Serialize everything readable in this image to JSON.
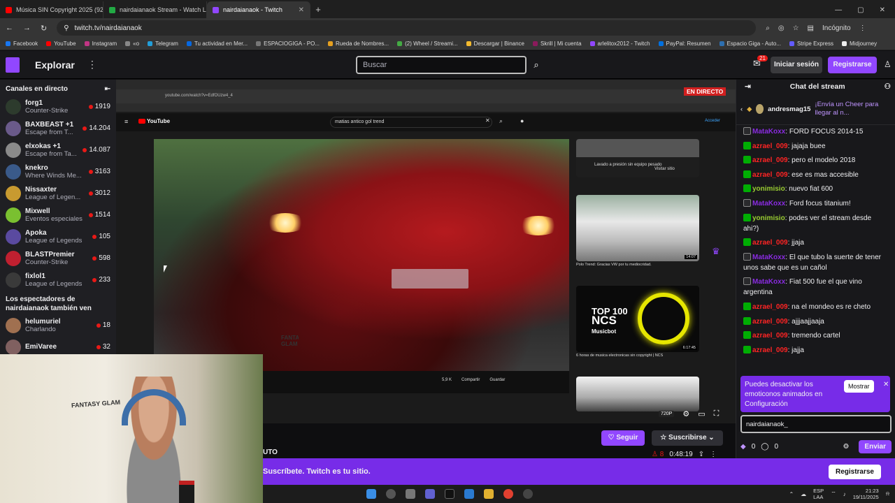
{
  "browser": {
    "tabs": [
      {
        "label": "Música SIN Copyright 2025 (92",
        "color": "#ff0000"
      },
      {
        "label": "nairdaianaok Stream - Watch Li",
        "color": "#22aa44"
      },
      {
        "label": "nairdaianaok - Twitch",
        "color": "#9147ff"
      }
    ],
    "new_tab": "+",
    "url": "twitch.tv/nairdaianaok",
    "mode": "Incógnito",
    "bookmarks": [
      "Facebook",
      "YouTube",
      "Instagram",
      "«o",
      "Telegram",
      "Tu actividad en Mer...",
      "ESPACIOGIGA - PO...",
      "Rueda de Nombres...",
      "(2) Wheel / Streami...",
      "Descargar | Binance",
      "Skrill | Mi cuenta",
      "arlelitox2012 - Twitch",
      "PayPal: Resumen",
      "Espacio Giga - Auto...",
      "Stripe Express",
      "Midjourney"
    ]
  },
  "twitch_nav": {
    "explore": "Explorar",
    "search_placeholder": "Buscar",
    "notif_count": "21",
    "login": "Iniciar sesión",
    "signup": "Registrarse"
  },
  "sidebar": {
    "title": "Canales en directo",
    "channels": [
      {
        "name": "forg1",
        "game": "Counter-Strike",
        "viewers": "1919",
        "color": "#2d3b2d"
      },
      {
        "name": "BAXBEAST +1",
        "game": "Escape from T...",
        "viewers": "14.204",
        "color": "#6a5a8a"
      },
      {
        "name": "elxokas +1",
        "game": "Escape from Ta...",
        "viewers": "14.087",
        "color": "#8a8a8a"
      },
      {
        "name": "knekro",
        "game": "Where Winds Me...",
        "viewers": "3163",
        "color": "#3a5a8a"
      },
      {
        "name": "Nissaxter",
        "game": "League of Legen...",
        "viewers": "3012",
        "color": "#c89a30"
      },
      {
        "name": "Mixwell",
        "game": "Eventos especiales",
        "viewers": "1514",
        "color": "#7ac030"
      },
      {
        "name": "Apoka",
        "game": "League of Legends",
        "viewers": "105",
        "color": "#5a4aa0"
      },
      {
        "name": "BLASTPremier",
        "game": "Counter-Strike",
        "viewers": "598",
        "color": "#c02030"
      },
      {
        "name": "fixlol1",
        "game": "League of Legends",
        "viewers": "233",
        "color": "#3a3a3a"
      }
    ],
    "section2": "Los espectadores de nairdaianaok también ven",
    "channels2": [
      {
        "name": "helumuriel",
        "game": "Charlando",
        "viewers": "18",
        "color": "#a07050"
      },
      {
        "name": "EmiVaree",
        "game": "",
        "viewers": "32",
        "color": "#806060"
      }
    ]
  },
  "video": {
    "live_badge": "EN DIRECTO",
    "youtube": {
      "logo": "YouTube",
      "search": "matias antico gol trend",
      "login": "Acceder",
      "url": "youtube.com/watch?v=EdfOUzw4_4",
      "ad_text": "Lavado a presión sin equipo pesado",
      "ad_button": "Visitar sitio",
      "rec1": "Polo Trend: Gracias VW por tu mediocridad.",
      "rec1_time": "14:07",
      "rec2_top": "TOP 100",
      "rec2_ncs": "NCS",
      "rec2_sub": "Musicbot",
      "rec2_title": "6 horas de musica electronicas sin copyright | NCS",
      "rec2_time": "6:17:45",
      "likes": "5,9 K",
      "share": "Compartir",
      "save": "Guardar"
    },
    "quality": "720P"
  },
  "webcam": {
    "brand": "FANTASY GLAM"
  },
  "info": {
    "title_fragment": "UTO",
    "follow": "Seguir",
    "subscribe": "Suscribirse",
    "viewers": "8",
    "uptime": "0:48:19"
  },
  "banner": {
    "text": "Suscríbete. Twitch es tu sitio.",
    "button": "Registrarse"
  },
  "chat": {
    "title": "Chat del stream",
    "pinned_user": "andresmag15",
    "pinned_text": "¡Envía un Cheer para llegar al n...",
    "messages": [
      {
        "user": "MataKoxx",
        "text": "FORD FOCUS 2014-15",
        "cls": "u-purple",
        "badge": "no"
      },
      {
        "user": "azrael_009",
        "text": "jajaja buee",
        "cls": "u-red",
        "badge": "mod"
      },
      {
        "user": "azrael_009",
        "text": "pero el modelo 2018",
        "cls": "u-red",
        "badge": "mod"
      },
      {
        "user": "azrael_009",
        "text": "ese es mas accesible",
        "cls": "u-red",
        "badge": "mod"
      },
      {
        "user": "yonimisio",
        "text": "nuevo fiat 600",
        "cls": "u-green",
        "badge": "mod"
      },
      {
        "user": "MataKoxx",
        "text": "Ford focus titanium!",
        "cls": "u-purple",
        "badge": "no"
      },
      {
        "user": "yonimisio",
        "text": "podes ver el stream desde ahi?)",
        "cls": "u-green",
        "badge": "mod"
      },
      {
        "user": "azrael_009",
        "text": "jjaja",
        "cls": "u-red",
        "badge": "mod"
      },
      {
        "user": "MataKoxx",
        "text": "El que tubo la suerte de tener unos sabe que es un cañol",
        "cls": "u-purple",
        "badge": "no"
      },
      {
        "user": "MataKoxx",
        "text": "Fiat 500 fue el que vino argentina",
        "cls": "u-purple",
        "badge": "no"
      },
      {
        "user": "azrael_009",
        "text": "na el mondeo es re cheto",
        "cls": "u-red",
        "badge": "mod"
      },
      {
        "user": "azrael_009",
        "text": "ajjjaajjaaja",
        "cls": "u-red",
        "badge": "mod"
      },
      {
        "user": "azrael_009",
        "text": "tremendo cartel",
        "cls": "u-red",
        "badge": "mod"
      },
      {
        "user": "azrael_009",
        "text": "jajja",
        "cls": "u-red",
        "badge": "mod"
      }
    ],
    "tip_text": "Puedes desactivar los emoticonos animados en Configuración",
    "tip_button": "Mostrar",
    "input_value": "nairdaianaok_",
    "points1": "0",
    "points2": "0",
    "send": "Enviar"
  },
  "taskbar": {
    "lang1": "ESP",
    "lang2": "LAA",
    "time": "21:23",
    "date": "19/11/2025"
  }
}
